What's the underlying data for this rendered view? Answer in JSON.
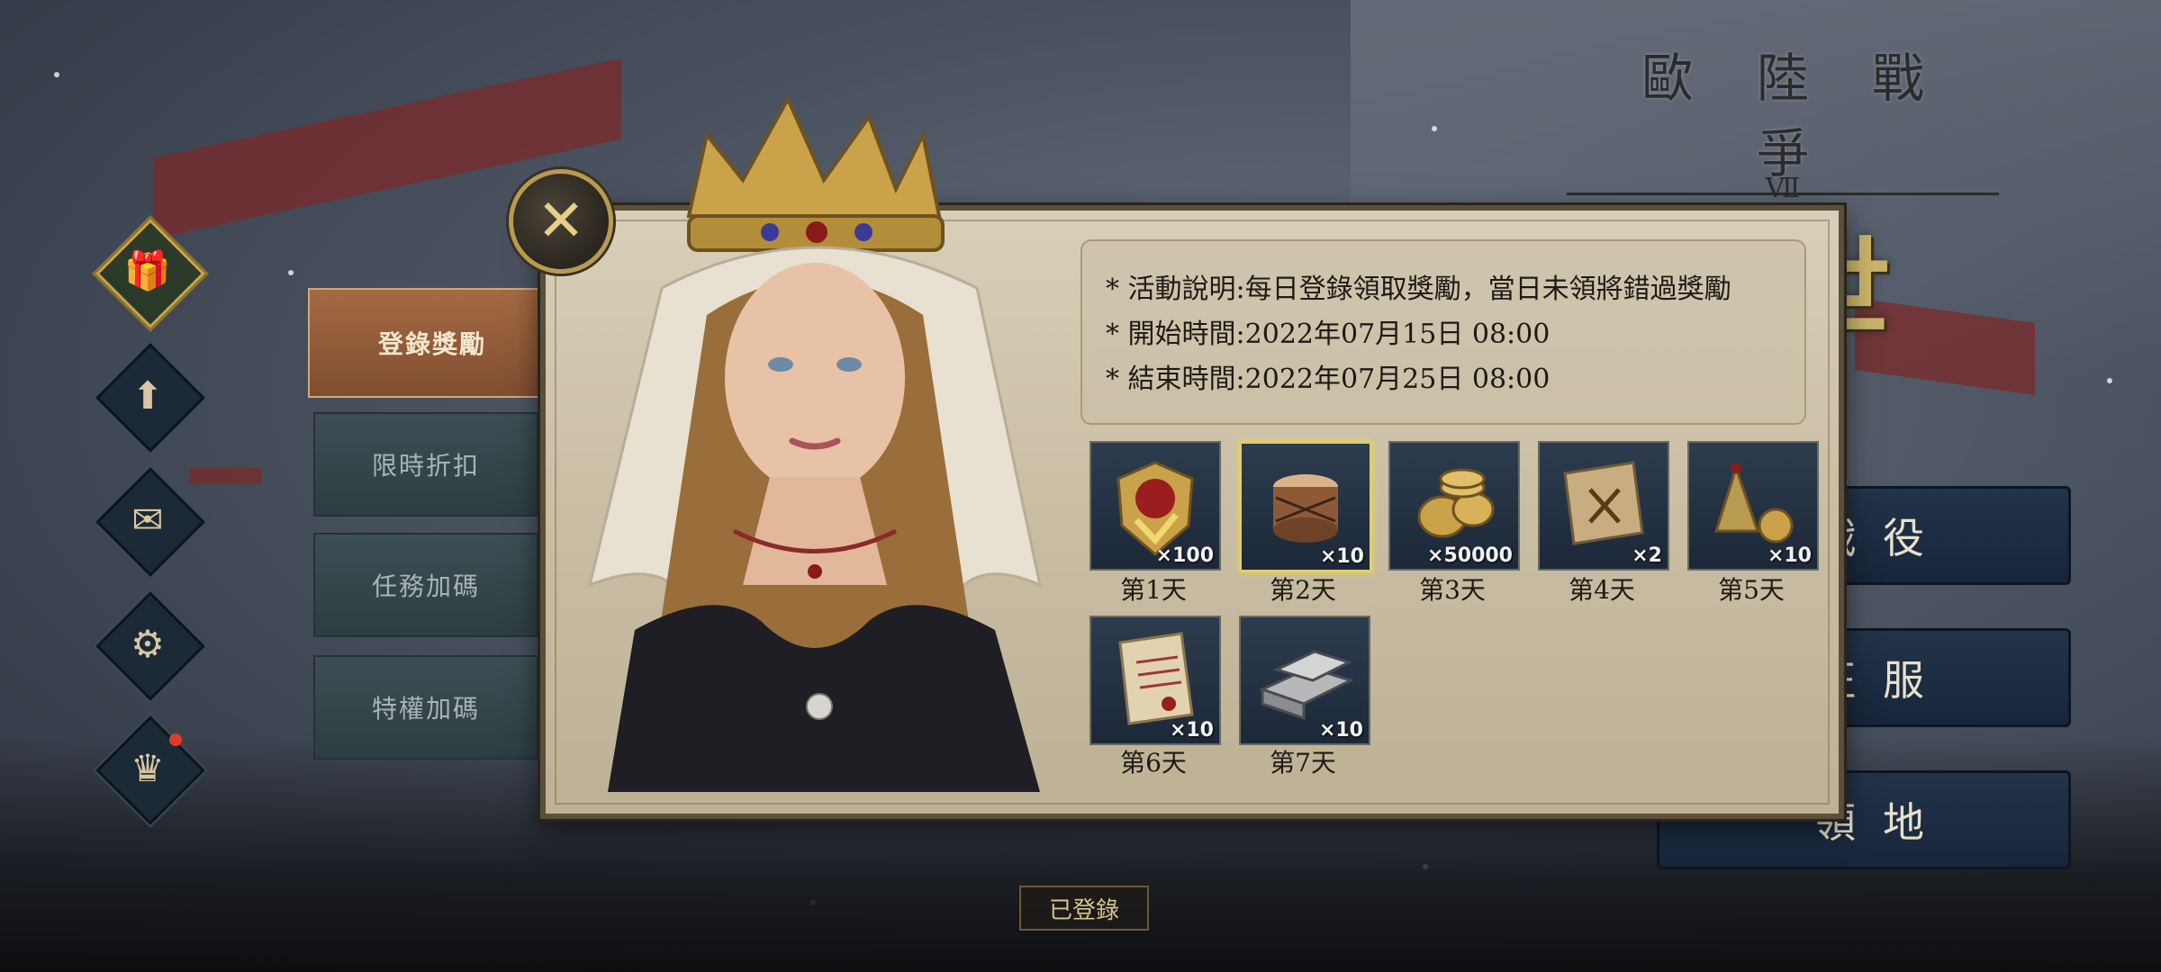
{
  "title": {
    "line1": "歐陸戰爭",
    "numeral": "Ⅶ",
    "line2": "中世紀"
  },
  "side_icons": [
    {
      "name": "gift-bag-icon",
      "glyph": "🎁",
      "active": true,
      "badge": false
    },
    {
      "name": "cloud-upload-icon",
      "glyph": "⬆",
      "active": false,
      "badge": false
    },
    {
      "name": "mail-icon",
      "glyph": "✉",
      "active": false,
      "badge": false
    },
    {
      "name": "gear-icon",
      "glyph": "⚙",
      "active": false,
      "badge": false
    },
    {
      "name": "crown-icon",
      "glyph": "♛",
      "active": false,
      "badge": true
    }
  ],
  "tabs": [
    {
      "label": "登錄獎勵",
      "active": true
    },
    {
      "label": "限時折扣",
      "active": false
    },
    {
      "label": "任務加碼",
      "active": false
    },
    {
      "label": "特權加碼",
      "active": false
    }
  ],
  "menu_buttons": [
    {
      "label": "戰役"
    },
    {
      "label": "征服"
    },
    {
      "label": "領地"
    }
  ],
  "close_icon": "✕",
  "info": {
    "description": "* 活動說明:每日登錄領取獎勵，當日未領將錯過獎勵",
    "start": "* 開始時間:2022年07月15日 08:00",
    "end": "* 結束時間:2022年07月25日 08:00"
  },
  "rewards": [
    {
      "day": "第1天",
      "count": "×100",
      "icon": "crest-badge-icon",
      "selected": false
    },
    {
      "day": "第2天",
      "count": "×10",
      "icon": "drum-icon",
      "selected": true
    },
    {
      "day": "第3天",
      "count": "×50000",
      "icon": "gold-coins-icon",
      "selected": false
    },
    {
      "day": "第4天",
      "count": "×2",
      "icon": "scroll-map-icon",
      "selected": false
    },
    {
      "day": "第5天",
      "count": "×10",
      "icon": "bell-weight-icon",
      "selected": false
    },
    {
      "day": "第6天",
      "count": "×10",
      "icon": "decree-scroll-icon",
      "selected": false
    },
    {
      "day": "第7天",
      "count": "×10",
      "icon": "iron-ingot-icon",
      "selected": false
    }
  ],
  "status": {
    "signed": "已登錄"
  },
  "colors": {
    "accent_gold": "#c8a64a",
    "active_tab": "#a56a44",
    "panel": "#d9cfb8",
    "badge_red": "#e23a2a"
  }
}
